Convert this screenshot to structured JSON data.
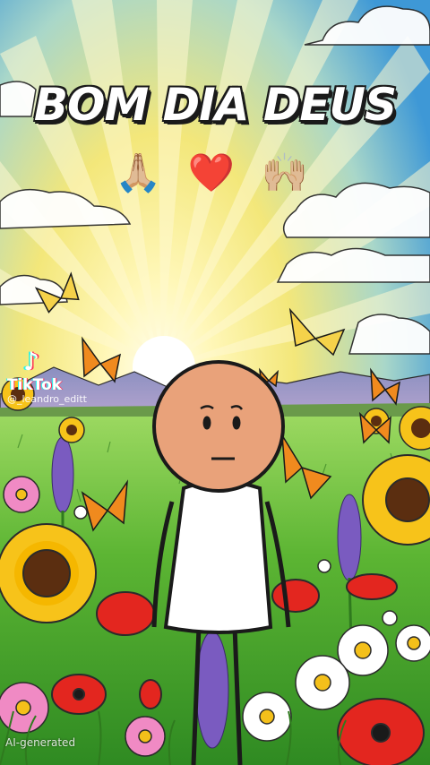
{
  "title": "BOM DIA DEUS",
  "emojis": {
    "praying_hands": "🙏🏼",
    "heart": "❤️",
    "raised_hands": "🙌🏼"
  },
  "watermark": {
    "logo_icon": "tiktok-note-icon",
    "brand": "TikTok",
    "username": "@_leandro_editt"
  },
  "ai_label": "AI-generated",
  "colors": {
    "sky": "#4a9fd8",
    "sun_glow": "#fff7c2",
    "grass": "#6cc33a",
    "character_skin": "#e9a27a"
  }
}
